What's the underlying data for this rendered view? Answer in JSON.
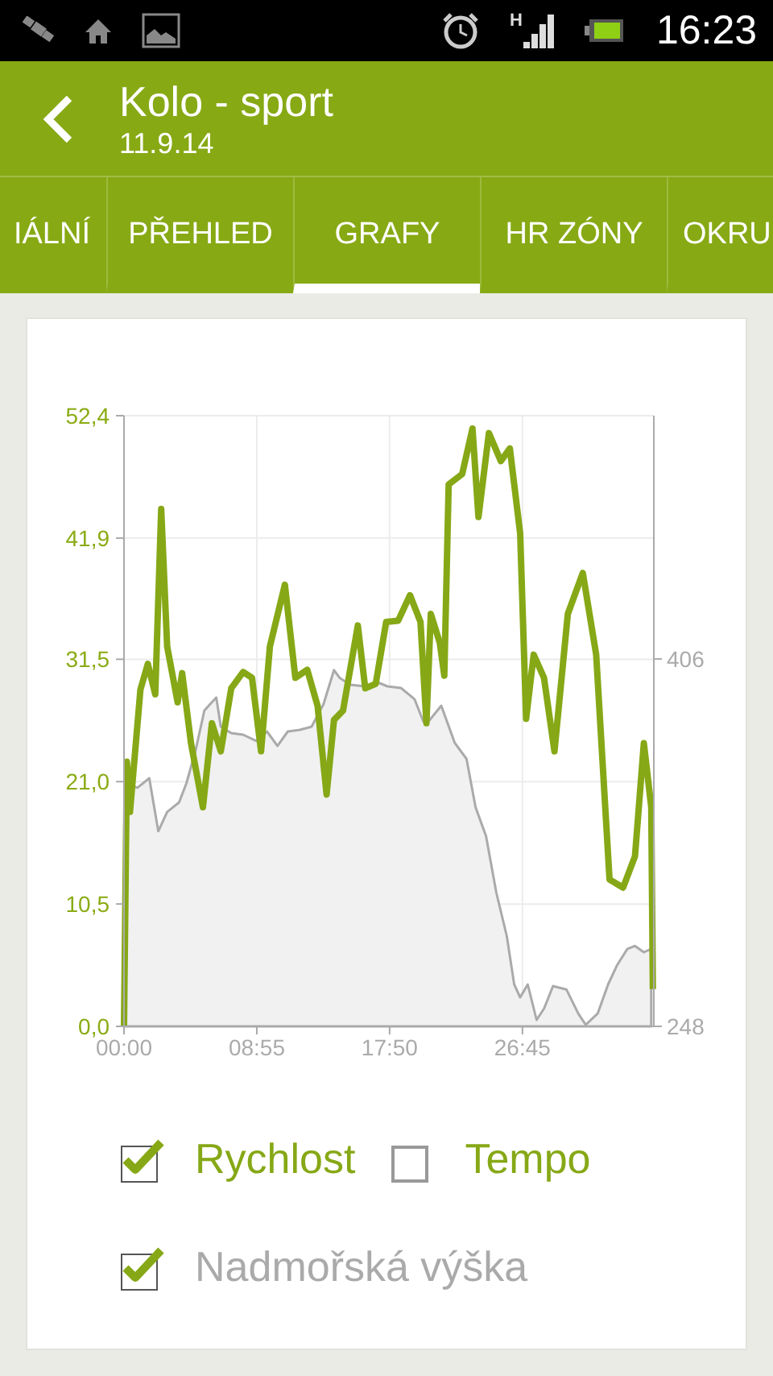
{
  "status_bar": {
    "network_type": "H",
    "time": "16:23"
  },
  "header": {
    "title": "Kolo - sport",
    "subtitle": "11.9.14"
  },
  "tabs": [
    {
      "label": "IÁLNÍ",
      "selected": false
    },
    {
      "label": "PŘEHLED",
      "selected": false
    },
    {
      "label": "GRAFY",
      "selected": true
    },
    {
      "label": "HR ZÓNY",
      "selected": false
    },
    {
      "label": "OKRU",
      "selected": false
    }
  ],
  "chart": {
    "chart_data": {
      "type": "line",
      "grid": true,
      "xlim": [
        0,
        35.57
      ],
      "ylim": [
        0,
        52.4
      ],
      "y2lim": [
        248,
        510.6
      ],
      "xticks": [
        {
          "value": 0,
          "label": "00:00"
        },
        {
          "value": 8.917,
          "label": "08:55"
        },
        {
          "value": 17.833,
          "label": "17:50"
        },
        {
          "value": 26.75,
          "label": "26:45"
        }
      ],
      "yticks": [
        {
          "value": 0,
          "label": "0,0"
        },
        {
          "value": 10.5,
          "label": "10,5"
        },
        {
          "value": 21,
          "label": "21,0"
        },
        {
          "value": 31.5,
          "label": "31,5"
        },
        {
          "value": 41.9,
          "label": "41,9"
        },
        {
          "value": 52.4,
          "label": "52,4"
        }
      ],
      "y2ticks": [
        248,
        406
      ],
      "series": [
        {
          "color": "#aaaaaa",
          "axis": "y2",
          "type": "area",
          "x": [
            0.1,
            0.9,
            1.7,
            2.3,
            2.9,
            3.7,
            4.2,
            4.8,
            5.4,
            6.2,
            6.5,
            7.2,
            8.0,
            8.9,
            9.6,
            10.3,
            11.0,
            11.8,
            12.6,
            13.4,
            14.1,
            14.5,
            15.2,
            16.2,
            16.9,
            17.7,
            18.6,
            19.5,
            20.1,
            20.5,
            21.3,
            22.2,
            23.0,
            23.6,
            24.3,
            25.0,
            25.7,
            26.2,
            26.6,
            27.1,
            27.7,
            28.2,
            28.8,
            29.7,
            30.5,
            31.0,
            31.8,
            32.5,
            33.1,
            33.8,
            34.3,
            34.9,
            35.4
          ],
          "values": [
            352.6,
            350.6,
            354.7,
            331.9,
            340.2,
            344.3,
            352.6,
            366.5,
            383.8,
            389.4,
            376.9,
            374.1,
            373.4,
            370.7,
            374.8,
            368.6,
            374.8,
            375.5,
            376.9,
            386.6,
            401.2,
            397.7,
            394.9,
            394.2,
            396.3,
            394.2,
            393.5,
            388.7,
            379.0,
            379.6,
            385.9,
            370.0,
            363.0,
            342.2,
            329.8,
            305.5,
            286.8,
            266.0,
            260.5,
            266.0,
            250.8,
            255.6,
            265.3,
            263.9,
            253.5,
            248.7,
            253.5,
            266.0,
            274.3,
            281.3,
            282.6,
            279.9,
            281.3
          ]
        },
        {
          "color": "#86a816",
          "x": [
            0.0,
            0.2,
            0.4,
            1.1,
            1.6,
            2.1,
            2.5,
            2.9,
            3.6,
            3.9,
            4.5,
            5.3,
            5.9,
            6.5,
            7.2,
            8.0,
            8.6,
            9.2,
            9.8,
            10.4,
            10.8,
            11.5,
            12.3,
            13.0,
            13.6,
            14.1,
            14.7,
            15.7,
            16.2,
            16.9,
            17.6,
            18.4,
            19.2,
            19.9,
            20.3,
            20.6,
            21.2,
            21.5,
            21.8,
            22.7,
            23.4,
            23.8,
            24.5,
            25.3,
            25.9,
            26.6,
            27.0,
            27.5,
            28.2,
            28.9,
            29.8,
            30.8,
            31.7,
            32.6,
            33.5,
            34.3,
            34.9,
            35.4,
            35.5
          ],
          "values": [
            0,
            22.7,
            18.4,
            28.9,
            31.1,
            28.5,
            44.4,
            32.6,
            27.8,
            30.3,
            24.3,
            18.8,
            26.0,
            23.6,
            29.0,
            30.4,
            29.9,
            23.6,
            32.6,
            35.8,
            37.9,
            29.9,
            30.6,
            27.5,
            19.9,
            26.3,
            27.1,
            34.4,
            29.0,
            29.4,
            34.7,
            34.8,
            37.0,
            34.7,
            26.0,
            35.4,
            32.9,
            30.1,
            46.5,
            47.4,
            51.3,
            43.7,
            50.9,
            48.5,
            49.6,
            42.3,
            26.4,
            31.9,
            29.9,
            23.6,
            35.4,
            38.9,
            31.9,
            12.6,
            11.9,
            14.6,
            24.3,
            18.8,
            3.2
          ]
        }
      ]
    }
  },
  "legend": [
    {
      "label": "Rychlost",
      "checked": true,
      "color": "#86a816"
    },
    {
      "label": "Tempo",
      "checked": false,
      "color": "#86a816"
    },
    {
      "label": "Nadmořská výška",
      "checked": true,
      "color": "#aaaaaa"
    }
  ]
}
